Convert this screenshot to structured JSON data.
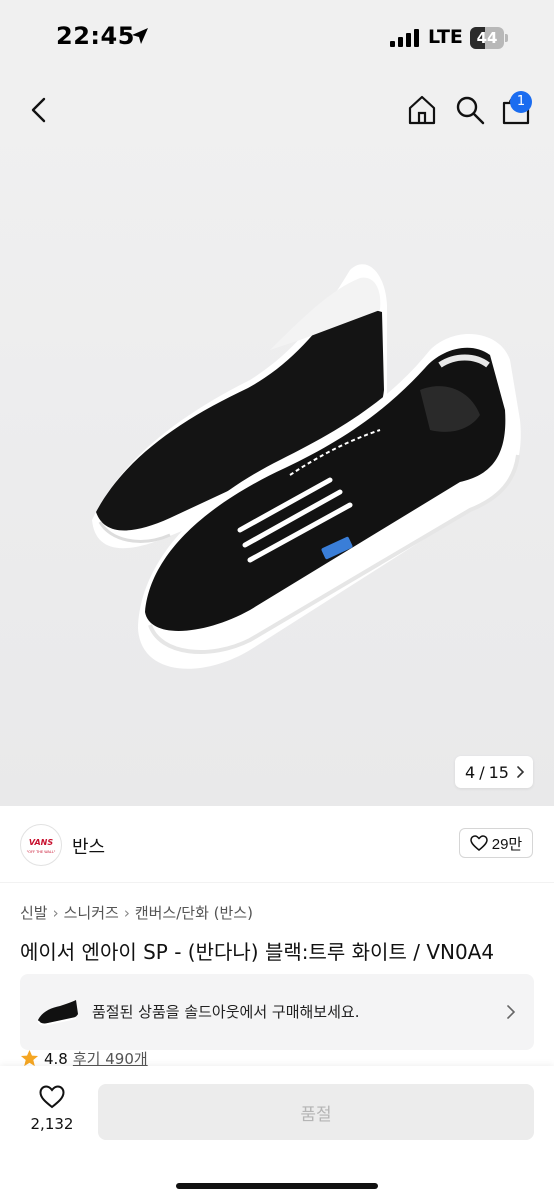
{
  "status": {
    "time": "22:45",
    "network": "LTE",
    "battery": "44",
    "battery_level": 0.44
  },
  "nav": {
    "back_icon": "chevron-left-icon",
    "home_icon": "home-icon",
    "search_icon": "search-icon",
    "cart_icon": "bag-icon",
    "cart_count": "1"
  },
  "gallery": {
    "current": "4",
    "separator": "/",
    "total": "15"
  },
  "brand": {
    "name": "반스",
    "logo_text": "VANS",
    "logo_tagline": "\"OFF THE WALL\"",
    "likes": "29만"
  },
  "breadcrumb": [
    "신발",
    "스니커즈",
    "캔버스/단화 (반스)"
  ],
  "product": {
    "title": "에이서 엔아이 SP - (반다나) 블랙:트루 화이트 / VN0A4"
  },
  "soldout_banner": {
    "text": "품절된 상품을 솔드아웃에서 구매해보세요."
  },
  "rating": {
    "score": "4.8",
    "reviews": "후기 490개"
  },
  "bottom": {
    "wish_count": "2,132",
    "buy_label": "품절"
  },
  "colors": {
    "accent": "#1a6cf0",
    "star": "#f5a623",
    "disabled_bg": "#ececec",
    "disabled_text": "#b5b5b5"
  }
}
